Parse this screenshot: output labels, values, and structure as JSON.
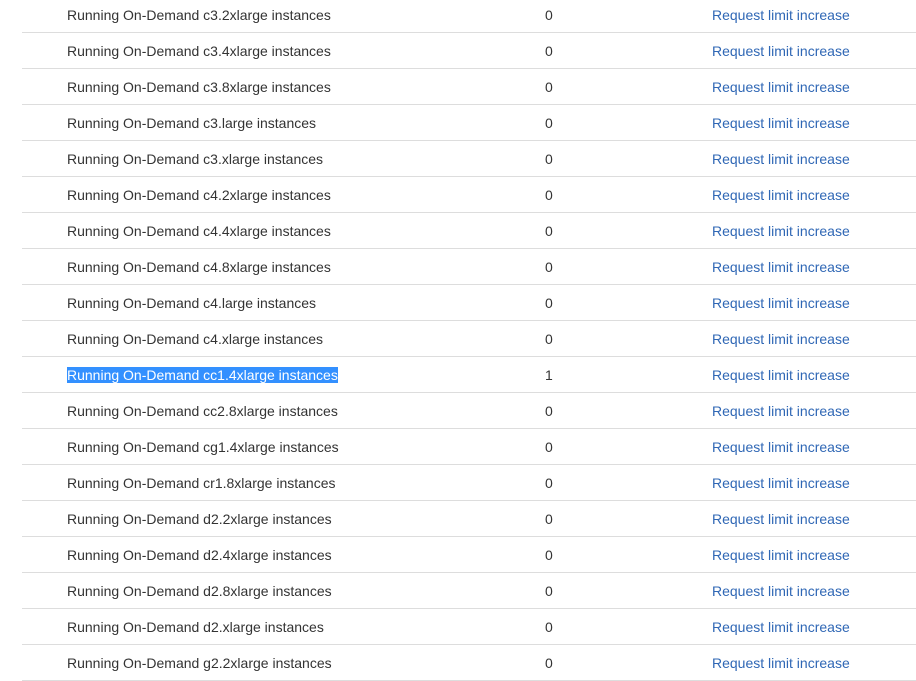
{
  "limits": {
    "link_label": "Request limit increase",
    "rows": [
      {
        "name": "Running On-Demand c3.2xlarge instances",
        "value": "0"
      },
      {
        "name": "Running On-Demand c3.4xlarge instances",
        "value": "0"
      },
      {
        "name": "Running On-Demand c3.8xlarge instances",
        "value": "0"
      },
      {
        "name": "Running On-Demand c3.large instances",
        "value": "0"
      },
      {
        "name": "Running On-Demand c3.xlarge instances",
        "value": "0"
      },
      {
        "name": "Running On-Demand c4.2xlarge instances",
        "value": "0"
      },
      {
        "name": "Running On-Demand c4.4xlarge instances",
        "value": "0"
      },
      {
        "name": "Running On-Demand c4.8xlarge instances",
        "value": "0"
      },
      {
        "name": "Running On-Demand c4.large instances",
        "value": "0"
      },
      {
        "name": "Running On-Demand c4.xlarge instances",
        "value": "0"
      },
      {
        "name": "Running On-Demand cc1.4xlarge instances",
        "value": "1",
        "selected": true
      },
      {
        "name": "Running On-Demand cc2.8xlarge instances",
        "value": "0"
      },
      {
        "name": "Running On-Demand cg1.4xlarge instances",
        "value": "0"
      },
      {
        "name": "Running On-Demand cr1.8xlarge instances",
        "value": "0"
      },
      {
        "name": "Running On-Demand d2.2xlarge instances",
        "value": "0"
      },
      {
        "name": "Running On-Demand d2.4xlarge instances",
        "value": "0"
      },
      {
        "name": "Running On-Demand d2.8xlarge instances",
        "value": "0"
      },
      {
        "name": "Running On-Demand d2.xlarge instances",
        "value": "0"
      },
      {
        "name": "Running On-Demand g2.2xlarge instances",
        "value": "0"
      }
    ]
  },
  "colors": {
    "link": "#2f67b5",
    "selection": "#3390ff",
    "divider": "#dddddd",
    "text": "#333333"
  }
}
